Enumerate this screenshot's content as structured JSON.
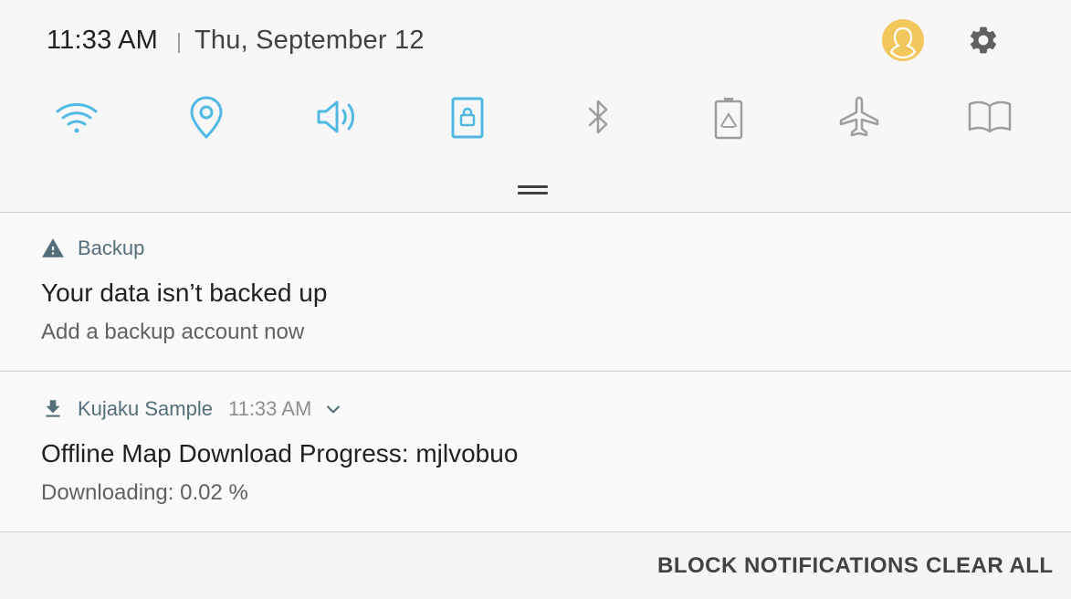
{
  "status": {
    "time": "11:33 AM",
    "date": "Thu, September 12"
  },
  "quick_settings": [
    {
      "icon": "wifi-icon",
      "active": true
    },
    {
      "icon": "location-icon",
      "active": true
    },
    {
      "icon": "sound-icon",
      "active": true
    },
    {
      "icon": "screen-lock-icon",
      "active": true
    },
    {
      "icon": "bluetooth-icon",
      "active": false
    },
    {
      "icon": "power-saving-icon",
      "active": false
    },
    {
      "icon": "airplane-mode-icon",
      "active": false
    },
    {
      "icon": "reading-mode-icon",
      "active": false
    }
  ],
  "colors": {
    "active": "#4fb8e3",
    "inactive": "#9e9e9e",
    "avatar": "#f2c75c"
  },
  "notifications": [
    {
      "app": "Backup",
      "icon": "warning-icon",
      "title": "Your data isn’t backed up",
      "text": "Add a backup account now"
    },
    {
      "app": "Kujaku Sample",
      "icon": "download-icon",
      "time": "11:33 AM",
      "title": "Offline Map Download Progress: mjlvobuo",
      "text": "Downloading: 0.02 %"
    }
  ],
  "footer": {
    "block": "BLOCK NOTIFICATIONS",
    "clear": "CLEAR ALL"
  }
}
